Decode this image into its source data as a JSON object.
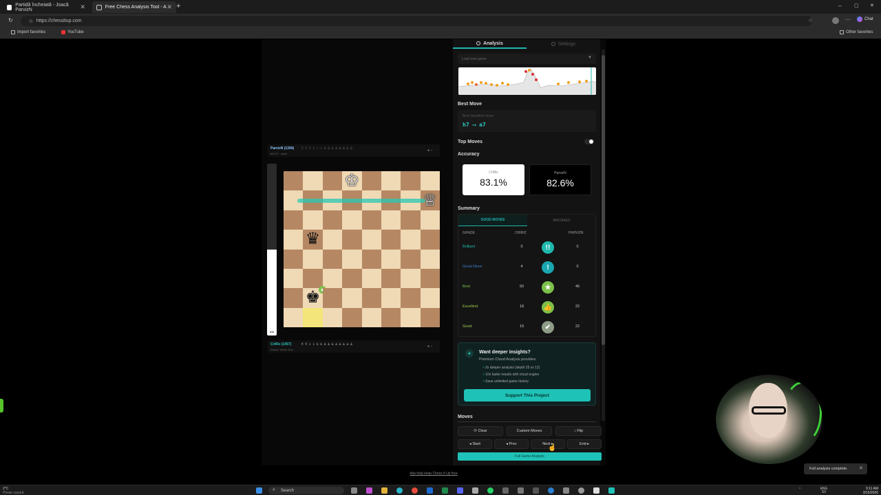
{
  "browser": {
    "tabs": [
      {
        "title": "Partidă încheiată - Joacă ParvizN",
        "active": false
      },
      {
        "title": "Free Chess Analysis Tool - Ad",
        "active": true
      }
    ],
    "new_tab": "+",
    "url": "https://chessitup.com",
    "favorites": [
      {
        "label": "Import favorites"
      },
      {
        "label": "YouTube"
      }
    ],
    "other_favorites": "Other favorites",
    "chat": "Chat",
    "window_controls": [
      "–",
      "▢",
      "✕"
    ]
  },
  "board": {
    "top_player": {
      "name": "ParvizN (1394)",
      "sub": "600+0 · rapid",
      "pieces": "♖♖♗♗♘♘♙♙♙♙♙♙♙♙"
    },
    "bottom_player": {
      "name": "CriRiz (1457)",
      "sub": "Result: White Won",
      "pieces": "♜♜♝♝♞♞♟♟♟♟♟♟♟♟"
    },
    "eval_text": "8.8",
    "eval_fraction": 0.5,
    "squares_light_color": "#f0d9b5",
    "squares_dark_color": "#b58863",
    "pieces": [
      {
        "square": "d8",
        "glyph": "♔",
        "side": "w"
      },
      {
        "square": "h7",
        "glyph": "♕",
        "side": "w"
      },
      {
        "square": "b5",
        "glyph": "♛",
        "side": "b"
      },
      {
        "square": "b2",
        "glyph": "♚",
        "side": "b"
      }
    ],
    "highlight_square": "b1",
    "best_badge": "★"
  },
  "panel": {
    "tabs": [
      {
        "label": "Analysis",
        "active": true
      },
      {
        "label": "Settings",
        "active": false
      }
    ],
    "load_game_placeholder": "Load new game",
    "load_game_arrow": "▼",
    "best_move": {
      "title": "Best Move",
      "label": "Best Stockfish move",
      "from": "h7",
      "arrow": "⟶",
      "to": "a7"
    },
    "top_moves_label": "Top Moves",
    "accuracy_title": "Accuracy",
    "accuracy": [
      {
        "name": "CriRiz",
        "value": "83.1%"
      },
      {
        "name": "ParvizN",
        "value": "82.6%"
      }
    ],
    "summary_title": "Summary",
    "summary_tabs": [
      {
        "label": "GOOD MOVES",
        "active": true
      },
      {
        "label": "MISTAKES",
        "active": false
      }
    ],
    "summary_headers": {
      "grade": "GRADE",
      "p1": "CRIRIZ",
      "p2": "PARVIZN"
    },
    "summary_rows": [
      {
        "grade": "Brilliant",
        "p1": "0",
        "p2": "0",
        "icon": "!!",
        "color": "#1fb8ae",
        "text_color": "#1fb8ae"
      },
      {
        "grade": "Great Move",
        "p1": "4",
        "p2": "0",
        "icon": "!",
        "color": "#1aa6b0",
        "text_color": "#3a7fc9"
      },
      {
        "grade": "Best",
        "p1": "50",
        "p2": "46",
        "icon": "★",
        "color": "#7cc04a",
        "text_color": "#7cc04a"
      },
      {
        "grade": "Excellent",
        "p1": "18",
        "p2": "22",
        "icon": "👍",
        "color": "#7cc04a",
        "text_color": "#9ccf4e"
      },
      {
        "grade": "Good",
        "p1": "19",
        "p2": "22",
        "icon": "✔",
        "color": "#8e9c86",
        "text_color": "#9ccf4e"
      }
    ],
    "promo": {
      "title": "Want deeper insights?",
      "subtitle": "Premium Cloud Analysis provides:",
      "items": [
        "2x deeper analysis (depth 25 vs 12)",
        "10x faster results with cloud engine",
        "Save unlimited game history"
      ],
      "button": "Support This Project",
      "icon": "✦"
    },
    "moves_title": "Moves",
    "buttons_row1": [
      "⟳ Clear",
      "Custom Moves",
      "↕ Flip"
    ],
    "buttons_row2": [
      "◂ Start",
      "◂ Prev",
      "Next ▸",
      "End ▸"
    ],
    "full_analysis": "Full Game Analysis"
  },
  "ads_line": "Ads help keep Chess It Up free",
  "toast": {
    "text": "Full analysis complete.",
    "close": "✕"
  },
  "taskbar": {
    "search": "Search",
    "weather_temp": "2°C",
    "weather_desc": "Ploaie ușoară",
    "lang1": "ENG",
    "lang2": "SV",
    "time": "9:11 AM",
    "date": "3/15/2026"
  }
}
